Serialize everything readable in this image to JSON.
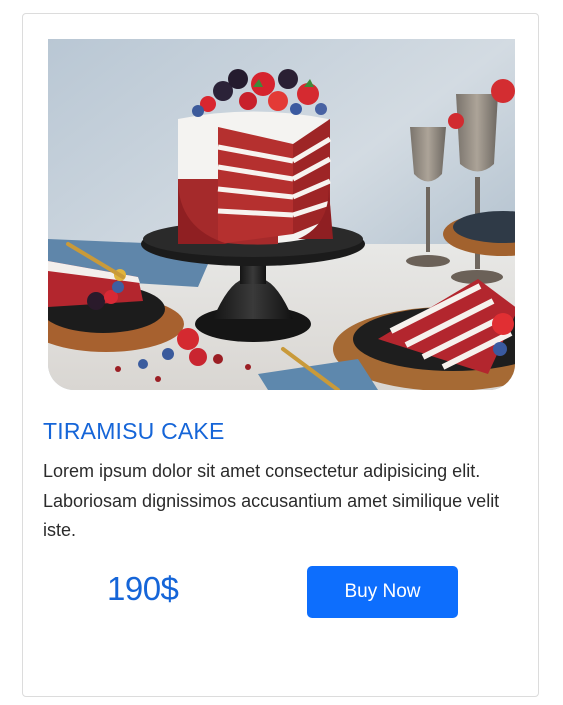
{
  "colors": {
    "accent": "#0d6efd",
    "title": "#1565d8",
    "text": "#2b2b2b",
    "border": "#dcdcdc"
  },
  "product": {
    "image_description_icon": "red-velvet-cake-photo",
    "title": "TIRAMISU CAKE",
    "description": "Lorem ipsum dolor sit amet consectetur adipisicing elit. Laboriosam dignissimos accusantium amet similique velit iste.",
    "price": "190$",
    "buy_label": "Buy Now"
  }
}
